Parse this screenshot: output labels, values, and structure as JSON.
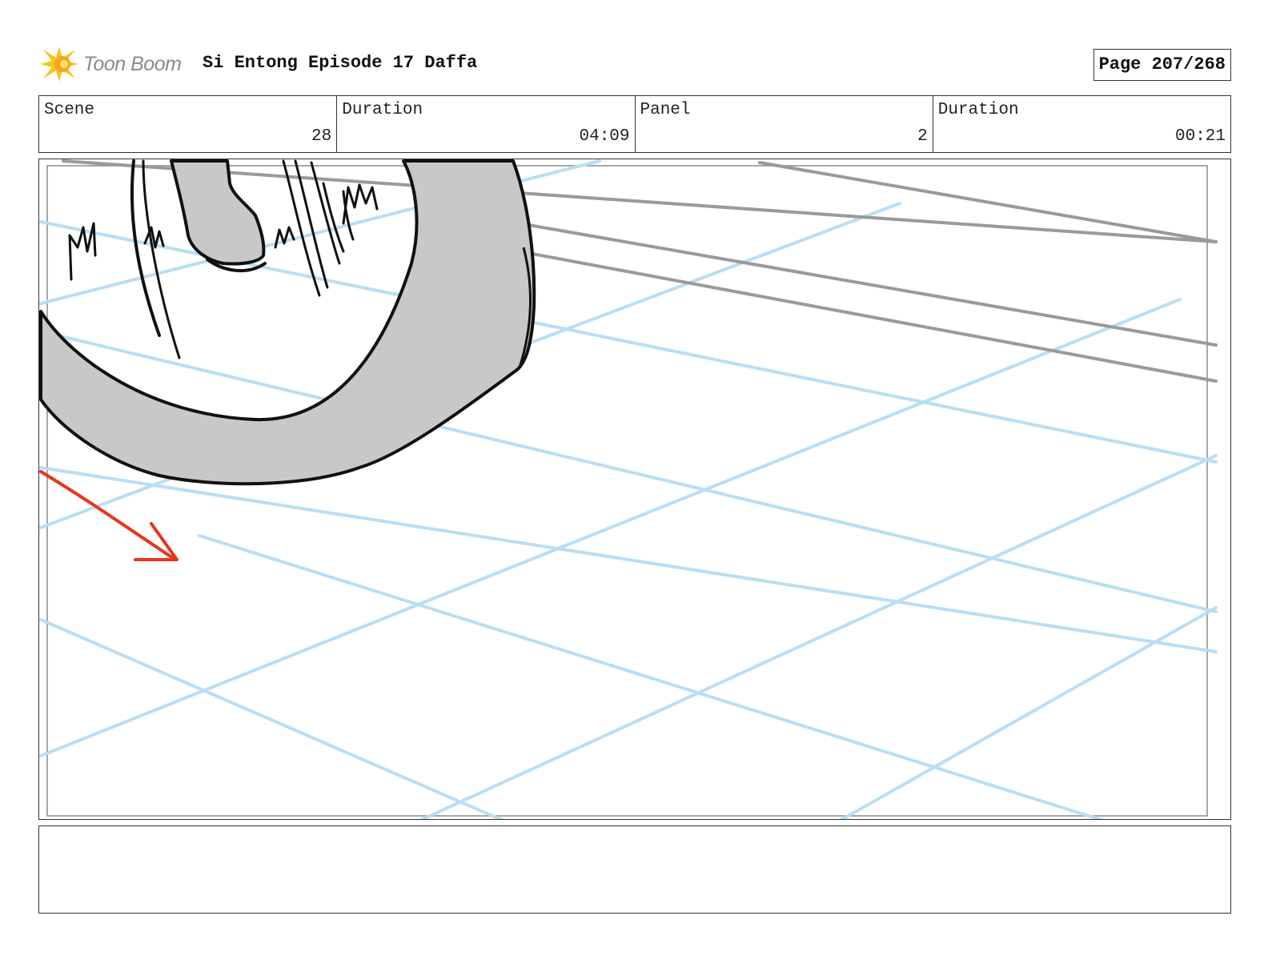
{
  "brand": {
    "name": "Toon Boom",
    "logo_icon": "toon-boom-star-burst"
  },
  "header": {
    "title": "Si Entong Episode 17 Daffa",
    "page": "Page 207/268"
  },
  "info": {
    "scene_label": "Scene",
    "scene_value": "28",
    "scene_duration_label": "Duration",
    "scene_duration_value": "04:09",
    "panel_label": "Panel",
    "panel_value": "2",
    "panel_duration_label": "Duration",
    "panel_duration_value": "00:21"
  },
  "panel": {
    "description": "",
    "colors": {
      "grid": "#b9def5",
      "ink": "#111111",
      "fill": "#c8c8c8",
      "motion_arrow": "#e8341c",
      "rail": "#9a9a9a"
    }
  },
  "notes": {
    "text": ""
  }
}
